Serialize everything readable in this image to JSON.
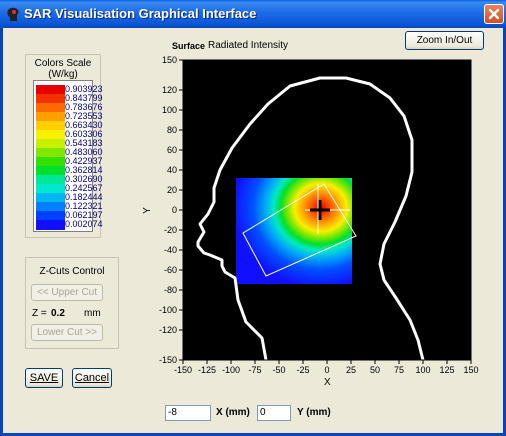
{
  "window": {
    "title": "SAR Visualisation Graphical Interface"
  },
  "plot": {
    "surface_label": "Surface",
    "surface_value": "Radiated Intensity",
    "zoom_label": "Zoom In/Out",
    "xlabel": "X",
    "ylabel": "Y",
    "xticks": [
      "-150",
      "-125",
      "-100",
      "-75",
      "-50",
      "-25",
      "0",
      "25",
      "50",
      "75",
      "100",
      "125",
      "150"
    ],
    "yticks": [
      "150",
      "120",
      "100",
      "80",
      "60",
      "40",
      "20",
      "0",
      "-20",
      "-40",
      "-60",
      "-80",
      "-100",
      "-120",
      "-150"
    ]
  },
  "colorscale": {
    "title_line1": "Colors Scale",
    "title_line2": "(W/kg)",
    "entries": [
      {
        "color": "#e60000",
        "value": "0.903923"
      },
      {
        "color": "#f23000",
        "value": "0.843799"
      },
      {
        "color": "#ff6a00",
        "value": "0.783676"
      },
      {
        "color": "#ff9f00",
        "value": "0.723553"
      },
      {
        "color": "#ffcf00",
        "value": "0.663430"
      },
      {
        "color": "#f8f000",
        "value": "0.603306"
      },
      {
        "color": "#c8f000",
        "value": "0.543183"
      },
      {
        "color": "#80e800",
        "value": "0.483060"
      },
      {
        "color": "#34e000",
        "value": "0.422937"
      },
      {
        "color": "#00e02c",
        "value": "0.362814"
      },
      {
        "color": "#00e896",
        "value": "0.302690"
      },
      {
        "color": "#00e8d0",
        "value": "0.242567"
      },
      {
        "color": "#00b8f0",
        "value": "0.182444"
      },
      {
        "color": "#0080ff",
        "value": "0.122321"
      },
      {
        "color": "#0040ff",
        "value": "0.062197"
      },
      {
        "color": "#1010ff",
        "value": "0.002074"
      }
    ]
  },
  "zcuts": {
    "title": "Z-Cuts Control",
    "upper_label": "<< Upper Cut",
    "z_label": "Z =",
    "z_value": "0.2",
    "z_unit": "mm",
    "lower_label": "Lower Cut >>"
  },
  "buttons": {
    "save": "SAVE",
    "cancel": "Cancel"
  },
  "coords": {
    "x_value": "-8",
    "x_label": "X (mm)",
    "y_value": "0",
    "y_label": "Y (mm)"
  }
}
